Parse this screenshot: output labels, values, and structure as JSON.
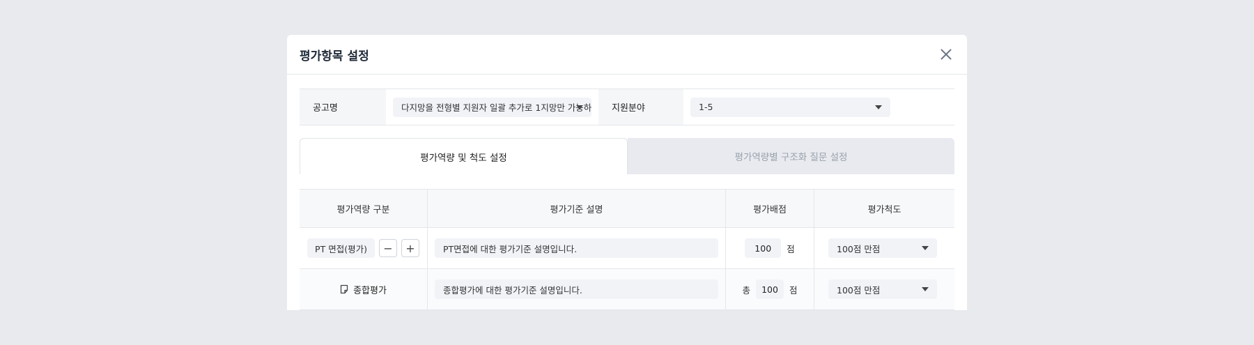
{
  "modal": {
    "title": "평가항목 설정"
  },
  "filter": {
    "posting_label": "공고명",
    "posting_value": "다지망을 전형별 지원자 일괄 추가로 1지망만 가능하",
    "field_label": "지원분야",
    "field_value": "1-5"
  },
  "tabs": [
    {
      "label": "평가역량 및 척도 설정",
      "active": true
    },
    {
      "label": "평가역량별 구조화 질문 설정",
      "active": false
    }
  ],
  "table": {
    "headers": [
      "평가역량 구분",
      "평가기준 설명",
      "평가배점",
      "평가척도"
    ],
    "rows": [
      {
        "competency": "PT 면접(평가)",
        "description": "PT면접에 대한 평가기준 설명입니다.",
        "score": "100",
        "score_unit": "점",
        "scale": "100점 만점"
      },
      {
        "competency": "종합평가",
        "description": "종합평가에 대한 평가기준 설명입니다.",
        "score_prefix": "총",
        "score": "100",
        "score_unit": "점",
        "scale": "100점 만점"
      }
    ]
  },
  "icons": {
    "close": "close-icon",
    "minus": "minus-icon",
    "plus": "plus-icon",
    "document": "document-icon",
    "caret": "caret-down-icon"
  }
}
